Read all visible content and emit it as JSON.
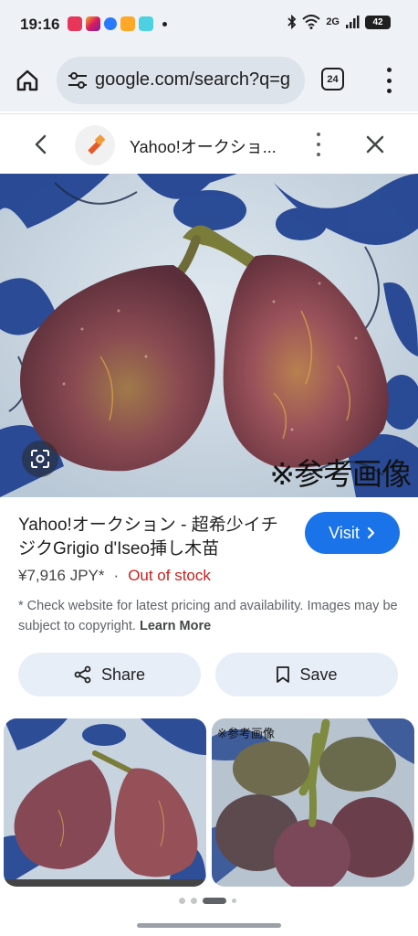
{
  "status_bar": {
    "time": "19:16",
    "network": "2G",
    "battery": "42",
    "icons": [
      "bluetooth-icon",
      "wifi-icon",
      "signal-icon"
    ]
  },
  "browser": {
    "url": "google.com/search?q=g",
    "tab_count": "24"
  },
  "panel": {
    "title": "Yahoo!オークショ...",
    "image_watermark": "※参考画像"
  },
  "product": {
    "title": "Yahoo!オークション - 超希少イチジクGrigio d'Iseo挿し木苗",
    "price": "¥7,916 JPY*",
    "separator": "·",
    "stock_status": "Out of stock",
    "disclaimer": "* Check website for latest pricing and availability. Images may be subject to copyright.",
    "learn_more": "Learn More",
    "visit_label": "Visit"
  },
  "actions": {
    "share_label": "Share",
    "save_label": "Save"
  },
  "related": {
    "thumb_2_caption": "※参考画像"
  },
  "colors": {
    "accent": "#1a73e8",
    "out_of_stock": "#c5221f",
    "chrome_bg": "#eef1f6"
  }
}
